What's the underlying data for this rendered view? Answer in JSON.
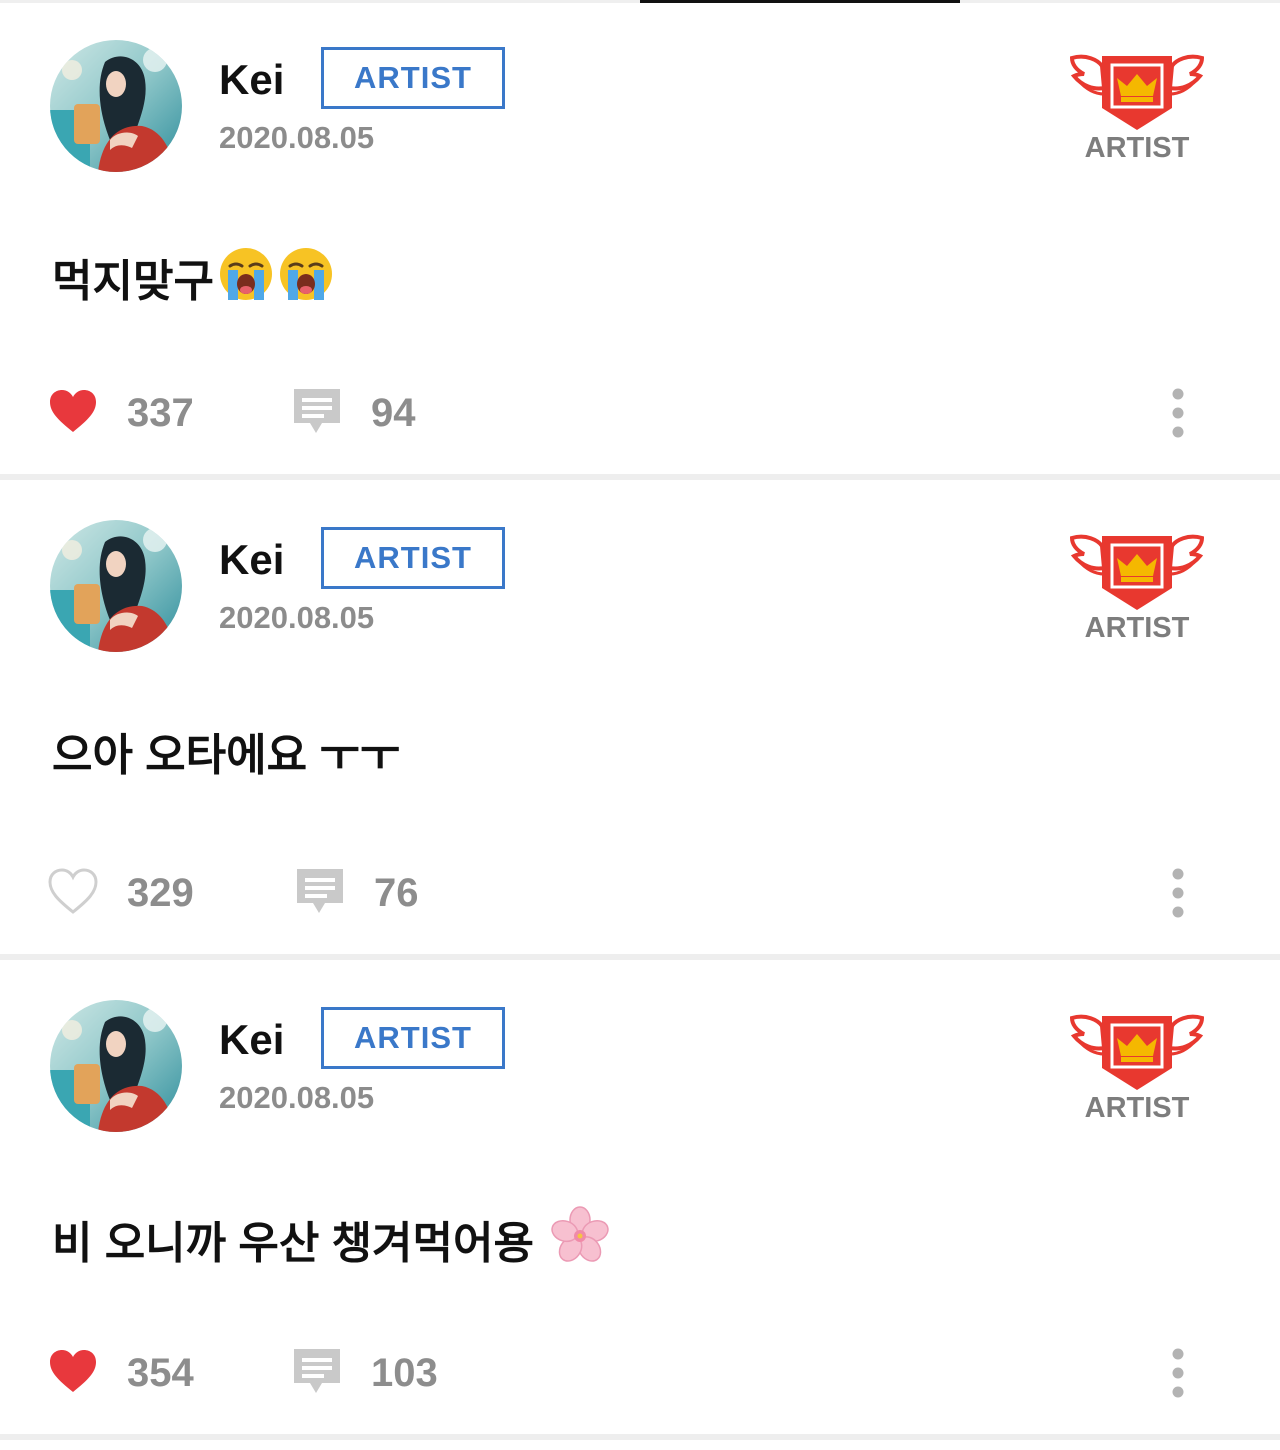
{
  "posts": [
    {
      "username": "Kei",
      "badge": "ARTIST",
      "date": "2020.08.05",
      "crest_label": "ARTIST",
      "text": "먹지맞구",
      "emoji": [
        "loudly-crying-face",
        "loudly-crying-face"
      ],
      "liked": true,
      "likes": "337",
      "comments": "94"
    },
    {
      "username": "Kei",
      "badge": "ARTIST",
      "date": "2020.08.05",
      "crest_label": "ARTIST",
      "text": "으아 오타에요 ㅜㅜ",
      "emoji": [],
      "liked": false,
      "likes": "329",
      "comments": "76"
    },
    {
      "username": "Kei",
      "badge": "ARTIST",
      "date": "2020.08.05",
      "crest_label": "ARTIST",
      "text": "비 오니까 우산 챙겨먹어용",
      "emoji": [
        "cherry-blossom"
      ],
      "liked": true,
      "likes": "354",
      "comments": "103"
    }
  ],
  "colors": {
    "heart_filled": "#e8383d",
    "badge_blue": "#3a78c9",
    "crest_red": "#e8382f",
    "crest_gold": "#f5b800",
    "muted_gray": "#8d8d8d"
  }
}
